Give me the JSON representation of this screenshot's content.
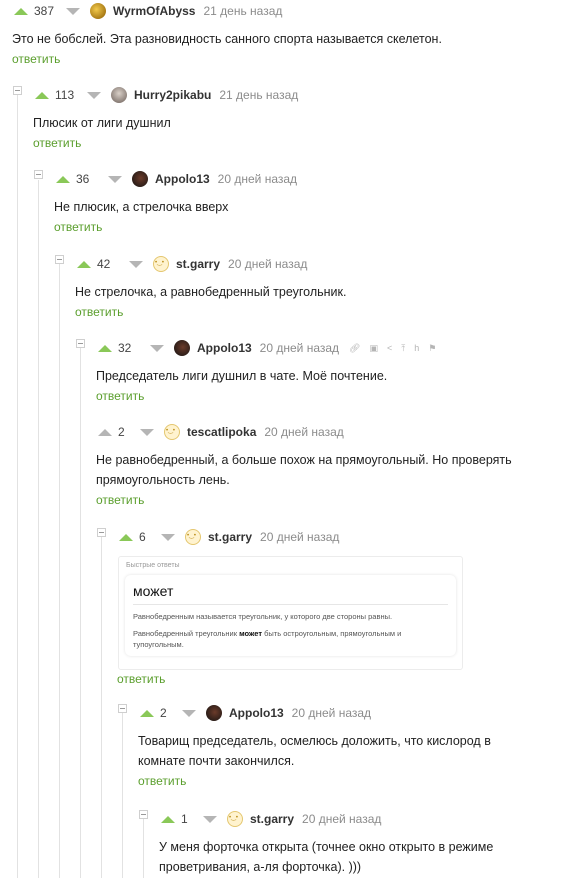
{
  "reply_label": "ответить",
  "comments": [
    {
      "rating": "387",
      "author": "WyrmOfAbyss",
      "time": "21 день назад",
      "text": "Это не бобслей. Эта разновидность санного спорта называется скелетон."
    },
    {
      "rating": "113",
      "author": "Hurry2pikabu",
      "time": "21 день назад",
      "text": "Плюсик от лиги душнил"
    },
    {
      "rating": "36",
      "author": "Appolo13",
      "time": "20 дней назад",
      "text": "Не плюсик, а стрелочка вверх"
    },
    {
      "rating": "42",
      "author": "st.garry",
      "time": "20 дней назад",
      "text": "Не стрелочка, а равнобедренный треугольник."
    },
    {
      "rating": "32",
      "author": "Appolo13",
      "time": "20 дней назад",
      "text": "Председатель лиги душнил в чате. Моё почтение."
    },
    {
      "rating": "2",
      "author": "tescatlipoka",
      "time": "20 дней назад",
      "text": "Не равнобедренный, а больше похож на прямоугольный. Но проверять прямоугольность лень."
    },
    {
      "rating": "6",
      "author": "st.garry",
      "time": "20 дней назад",
      "text": ""
    },
    {
      "rating": "2",
      "author": "Appolo13",
      "time": "20 дней назад",
      "text": "Товарищ председатель, осмелюсь доложить, что кислород в комнате почти закончился."
    },
    {
      "rating": "1",
      "author": "st.garry",
      "time": "20 дней назад",
      "text": "У меня форточка открыта (точнее окно открыто в режиме проветривания, а-ля форточка). )))"
    }
  ],
  "quick_answer": {
    "label": "Быстрые ответы",
    "title": "может",
    "line1": "Равнобедренным называется треугольник, у которого две стороны равны.",
    "line2_before": "Равнобедренный треугольник ",
    "line2_bold": "может",
    "line2_after": " быть остроугольным, прямоугольным и тупоугольным."
  },
  "colors": {
    "accent": "#8ac858",
    "link": "#5a9e2c",
    "muted": "#8b8b8b"
  },
  "icons": [
    "link-icon",
    "save-icon",
    "share-icon",
    "scroll-up-icon",
    "hide-icon",
    "report-flag-icon"
  ]
}
